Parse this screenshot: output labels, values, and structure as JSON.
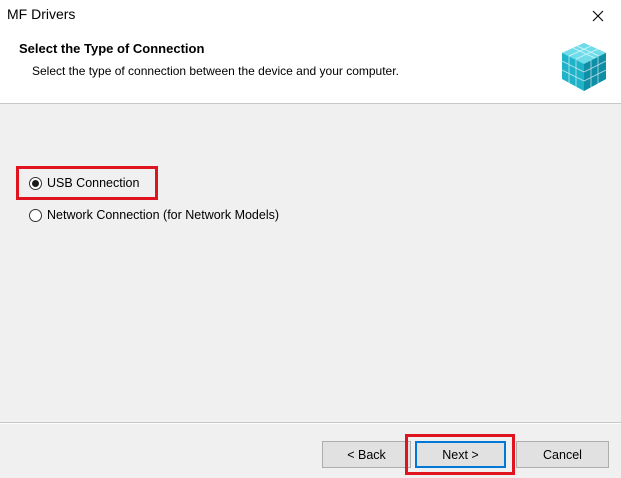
{
  "window": {
    "title": "MF Drivers"
  },
  "header": {
    "title": "Select the Type of Connection",
    "subtitle": "Select the type of connection between the device and your computer."
  },
  "options": [
    {
      "label": "USB Connection",
      "selected": true
    },
    {
      "label": "Network Connection (for Network Models)",
      "selected": false
    }
  ],
  "buttons": {
    "back": "< Back",
    "next": "Next >",
    "cancel": "Cancel"
  },
  "colors": {
    "highlight": "#e0141e",
    "accent": "#0078d7"
  },
  "icons": {
    "close": "close-icon",
    "logo": "cube-logo-icon"
  }
}
